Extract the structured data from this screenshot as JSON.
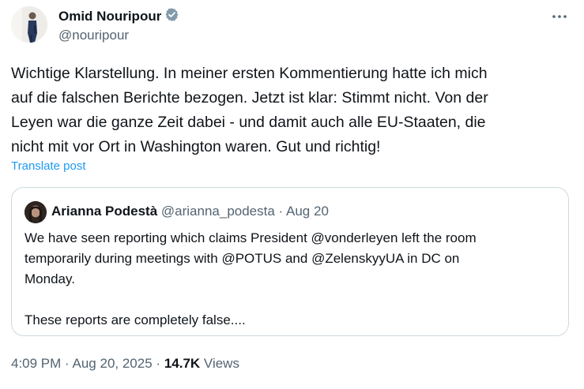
{
  "author": {
    "name": "Omid Nouripour",
    "handle": "@nouripour"
  },
  "tweet": {
    "text": "Wichtige Klarstellung. In meiner ersten Kommentierung hatte ich mich\nauf die falschen Berichte bezogen. Jetzt ist klar: Stimmt nicht. Von der\nLeyen war die ganze Zeit dabei - und damit auch alle EU-Staaten, die\nnicht mit vor Ort in Washington waren. Gut und richtig!",
    "translate_label": "Translate post"
  },
  "quoted": {
    "name": "Arianna Podestà",
    "handle": "@arianna_podesta",
    "separator": "·",
    "date": "Aug 20",
    "text": "We have seen reporting which claims President @vonderleyen left the room\ntemporarily during meetings with @POTUS and @ZelenskyyUA in DC on\nMonday.\n\nThese reports are completely false...."
  },
  "footer": {
    "time": "4:09 PM",
    "sep1": "·",
    "date": "Aug 20, 2025",
    "sep2": "·",
    "views_count": "14.7K",
    "views_label": "Views"
  },
  "icons": {
    "verified": "verified-badge-icon",
    "more": "more-dots-icon"
  },
  "colors": {
    "link": "#1d9bf0",
    "muted": "#536471",
    "text": "#0f1419",
    "border": "#cfd9de"
  }
}
